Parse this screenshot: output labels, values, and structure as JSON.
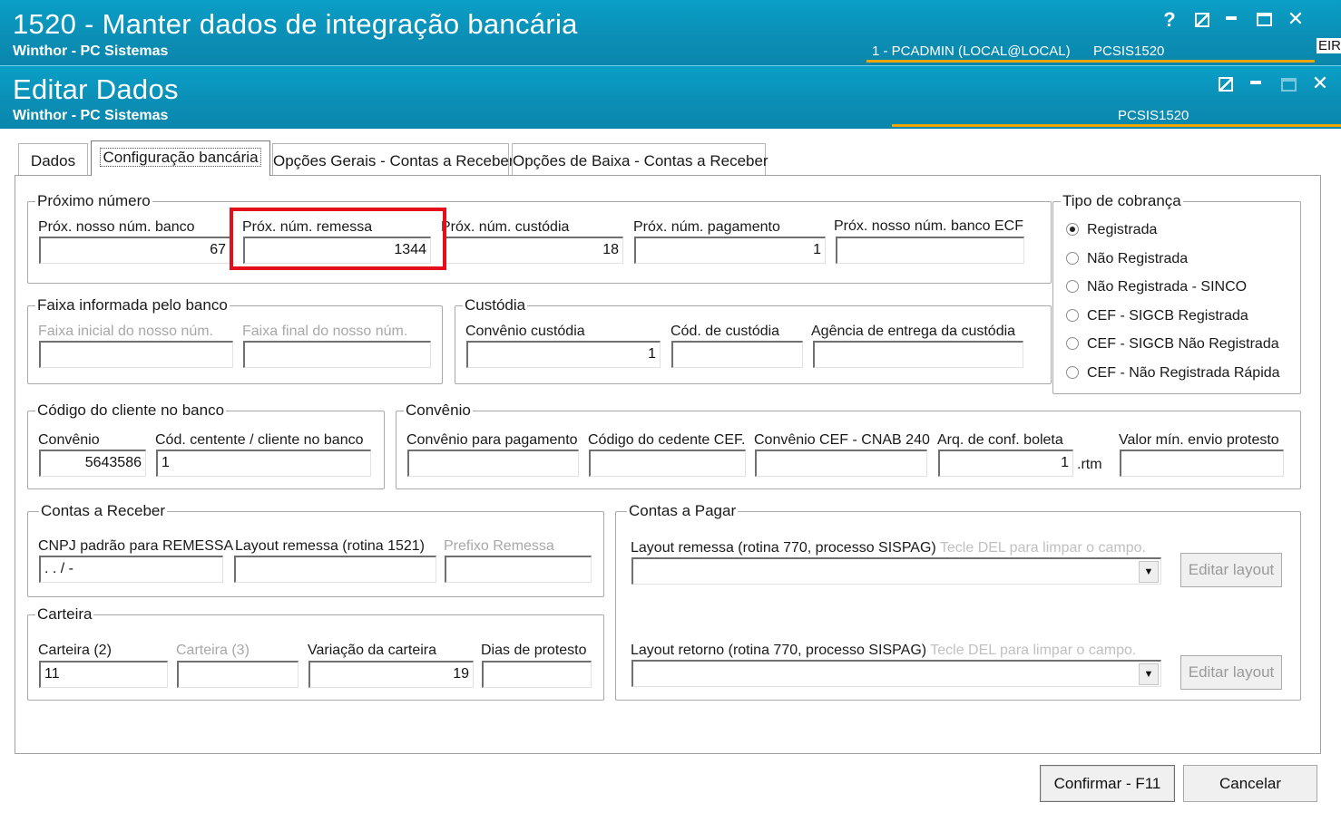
{
  "window": {
    "title": "1520 - Manter dados de integração bancária",
    "subtitle": "Winthor - PC Sistemas",
    "user": "1 - PCADMIN (LOCAL@LOCAL)",
    "module": "PCSIS1520",
    "clipped_text": "EIR",
    "help_glyph": "?",
    "min_glyph": "_",
    "close_glyph": "✕"
  },
  "dialog": {
    "title": "Editar Dados",
    "subtitle": "Winthor - PC Sistemas",
    "module": "PCSIS1520",
    "min_glyph": "_",
    "close_glyph": "✕"
  },
  "tabs": [
    {
      "label": "Dados"
    },
    {
      "label": "Configuração bancária"
    },
    {
      "label": "Opções Gerais - Contas a Receber"
    },
    {
      "label": "Opções de Baixa - Contas a Receber"
    }
  ],
  "proximo_numero": {
    "legend": "Próximo número",
    "fields": [
      {
        "label": "Próx. nosso núm. banco",
        "value": "67"
      },
      {
        "label": "Próx. núm. remessa",
        "value": "1344"
      },
      {
        "label": "Próx. núm. custódia",
        "value": "18"
      },
      {
        "label": "Próx. núm. pagamento",
        "value": "1"
      },
      {
        "label": "Próx. nosso núm. banco ECF",
        "value": ""
      }
    ]
  },
  "tipo_cobranca": {
    "legend": "Tipo de cobrança",
    "options": [
      {
        "label": "Registrada",
        "selected": true
      },
      {
        "label": "Não Registrada",
        "selected": false
      },
      {
        "label": "Não Registrada - SINCO",
        "selected": false
      },
      {
        "label": "CEF - SIGCB Registrada",
        "selected": false
      },
      {
        "label": "CEF - SIGCB Não Registrada",
        "selected": false
      },
      {
        "label": "CEF - Não Registrada Rápida",
        "selected": false
      }
    ]
  },
  "faixa": {
    "legend": "Faixa informada pelo banco",
    "inicial_label": "Faixa inicial do nosso núm.",
    "final_label": "Faixa final do nosso núm."
  },
  "custodia": {
    "legend": "Custódia",
    "convenio_label": "Convênio custódia",
    "convenio_value": "1",
    "cod_label": "Cód. de custódia",
    "agencia_label": "Agência de entrega da custódia"
  },
  "codigo_cliente": {
    "legend": "Código do cliente no banco",
    "convenio_label": "Convênio",
    "convenio_value": "5643586",
    "cedente_label": "Cód. centente / cliente no banco",
    "cedente_value": "1"
  },
  "convenio": {
    "legend": "Convênio",
    "pagamento_label": "Convênio para pagamento",
    "cedente_cef_label": "Código do cedente CEF.",
    "cnab_label": "Convênio CEF - CNAB 240",
    "arq_label": "Arq. de conf. boleta",
    "arq_value": "1",
    "arq_ext": ".rtm",
    "valor_label": "Valor mín. envio protesto"
  },
  "contas_receber": {
    "legend": "Contas a Receber",
    "cnpj_label": "CNPJ padrão para REMESSA",
    "cnpj_mask": " .  .  /  -",
    "layout_label": "Layout remessa (rotina 1521)",
    "prefixo_label": "Prefixo Remessa"
  },
  "carteira": {
    "legend": "Carteira",
    "carteira2_label": "Carteira (2)",
    "carteira2_value": "11",
    "carteira3_label": "Carteira (3)",
    "variacao_label": "Variação da carteira",
    "variacao_value": "19",
    "dias_label": "Dias de protesto"
  },
  "contas_pagar": {
    "legend": "Contas a Pagar",
    "remessa_label": "Layout remessa (rotina 770, processo SISPAG)",
    "remessa_hint": "Tecle DEL para limpar o campo.",
    "retorno_label": "Layout retorno (rotina 770, processo SISPAG)",
    "retorno_hint": "Tecle DEL para limpar o campo.",
    "editar_label": "Editar layout",
    "combo_glyph": "▼"
  },
  "buttons": {
    "confirmar": "Confirmar - F11",
    "cancelar": "Cancelar"
  }
}
